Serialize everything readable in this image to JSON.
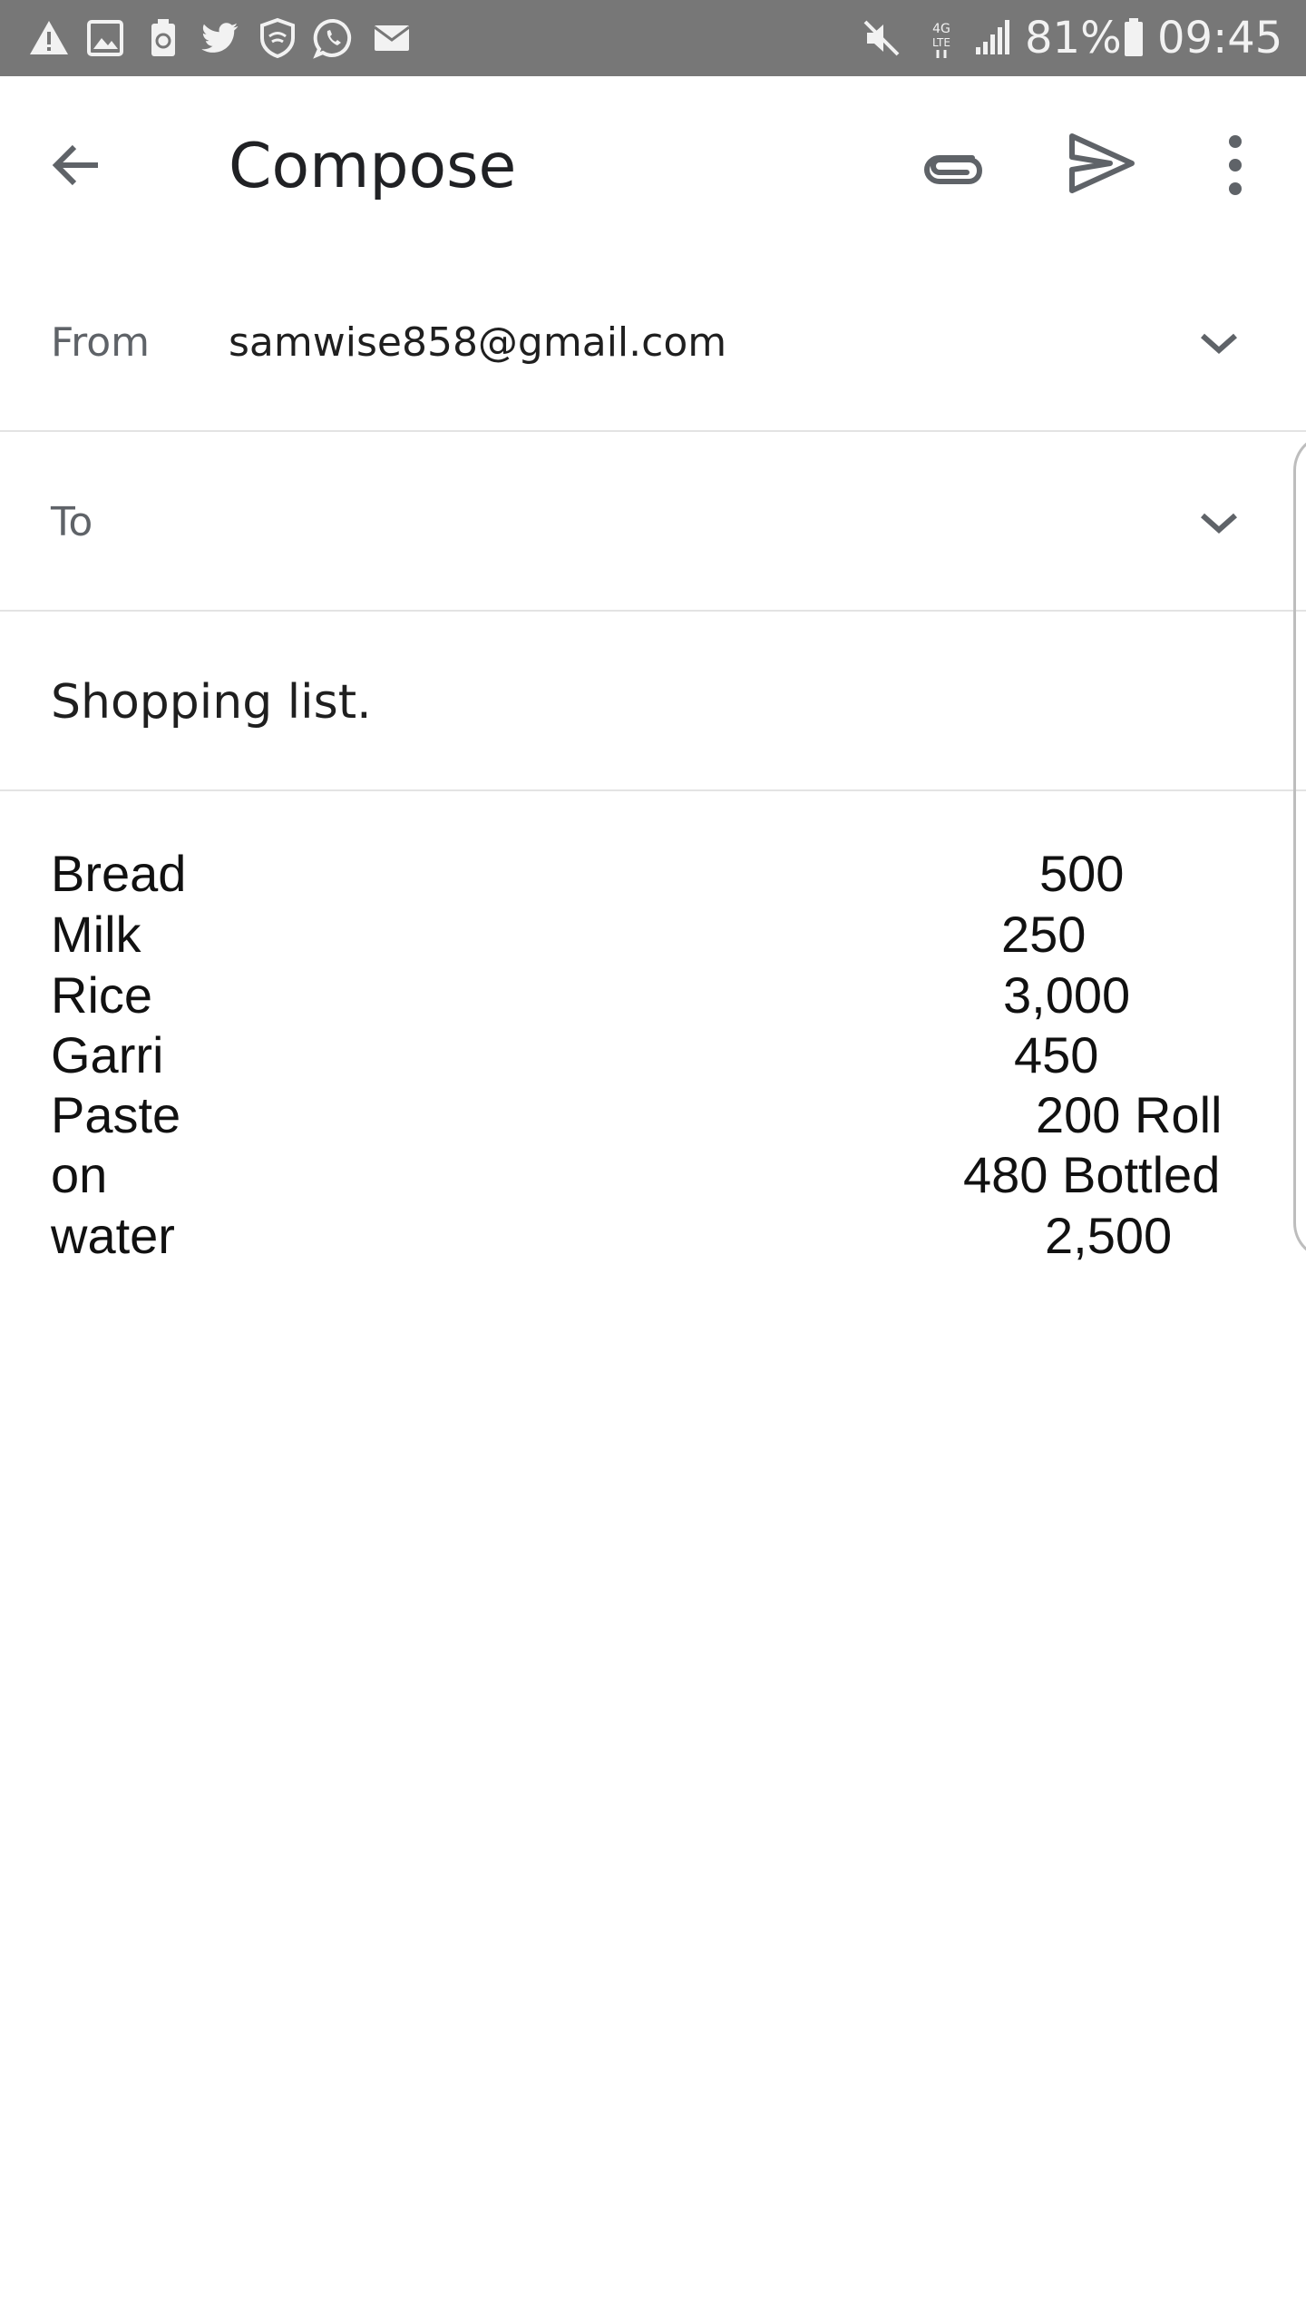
{
  "status_bar": {
    "icons_left": [
      "warning-icon",
      "image-icon",
      "recycle-battery-icon",
      "twitter-icon",
      "vpn-shield-icon",
      "whatsapp-icon",
      "mail-icon"
    ],
    "icons_right": [
      "mute-icon",
      "4g-lte-icon",
      "signal-icon",
      "battery-icon"
    ],
    "battery": "81%",
    "time": "09:45"
  },
  "app_bar": {
    "title": "Compose",
    "back_icon": "arrow-back-icon",
    "attach_icon": "paperclip-icon",
    "send_icon": "send-icon",
    "menu_icon": "more-vert-icon"
  },
  "compose": {
    "from_label": "From",
    "from_value": "samwise858@gmail.com",
    "to_label": "To",
    "to_value": "",
    "subject": "Shopping list.",
    "body_lines": [
      {
        "item": "Bread",
        "value": "500"
      },
      {
        "item": "Milk",
        "value": "250"
      },
      {
        "item": "Rice",
        "value": "3,000"
      },
      {
        "item": "Garri",
        "value": "450"
      },
      {
        "item": "Paste",
        "value": "200 Roll"
      },
      {
        "item": "on",
        "value": "480 Bottled"
      },
      {
        "item": "water",
        "value": "2,500"
      }
    ]
  },
  "colors": {
    "status_bar_bg": "#777777",
    "divider": "#e3e3e3",
    "icon_gray": "#5f6368"
  }
}
